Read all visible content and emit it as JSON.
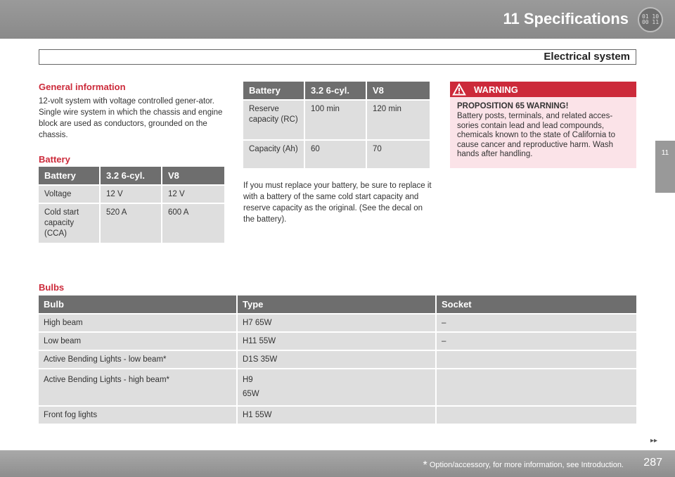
{
  "header": {
    "chapter_title": "11 Specifications",
    "chapter_icon_text": "01 10\n00 11",
    "section_title": "Electrical system",
    "side_tab": "11"
  },
  "general": {
    "heading": "General information",
    "text": "12-volt system with voltage controlled gener-ator. Single wire system in which the chassis and engine block are used as conductors, grounded on the chassis."
  },
  "battery_table_1": {
    "heading": "Battery",
    "columns": [
      "Battery",
      "3.2 6-cyl.",
      "V8"
    ],
    "rows": [
      [
        "Voltage",
        "12 V",
        "12 V"
      ],
      [
        "Cold start capacity (CCA)",
        "520 A",
        "600 A"
      ]
    ]
  },
  "battery_table_2": {
    "columns": [
      "Battery",
      "3.2 6-cyl.",
      "V8"
    ],
    "rows": [
      [
        "Reserve capacity (RC)",
        "100 min",
        "120 min"
      ],
      [
        "Capacity (Ah)",
        "60",
        "70"
      ]
    ]
  },
  "replace_text": "If you must replace your battery, be sure to replace it with a battery of the same cold start capacity and reserve capacity as the original. (See the decal on the battery).",
  "warning": {
    "title": "WARNING",
    "subtitle": "PROPOSITION 65 WARNING!",
    "text": "Battery posts, terminals, and related acces-sories contain lead and lead compounds, chemicals known to the state of California to cause cancer and reproductive harm. Wash hands after handling.",
    "color": "#cc2a3a"
  },
  "bulbs": {
    "heading": "Bulbs",
    "columns": [
      "Bulb",
      "Type",
      "Socket"
    ],
    "rows": [
      {
        "bulb": "High beam",
        "type": "H7 65W",
        "type2": "",
        "socket": "–"
      },
      {
        "bulb": "Low beam",
        "type": "H11 55W",
        "type2": "",
        "socket": "–"
      },
      {
        "bulb": "Active Bending Lights - low beam*",
        "type": "D1S 35W",
        "type2": "",
        "socket": ""
      },
      {
        "bulb": "Active Bending Lights - high beam*",
        "type": "H9",
        "type2": "65W",
        "socket": ""
      },
      {
        "bulb": "Front fog lights",
        "type": "H1 55W",
        "type2": "",
        "socket": ""
      }
    ]
  },
  "footer": {
    "star": "*",
    "note": "Option/accessory, for more information, see Introduction.",
    "page": "287",
    "next_arrows": "▸▸"
  },
  "colors": {
    "accent_red": "#cc2a3a",
    "table_header": "#6e6e6e",
    "table_cell": "#dedede",
    "warning_bg": "#fbe3e8"
  }
}
